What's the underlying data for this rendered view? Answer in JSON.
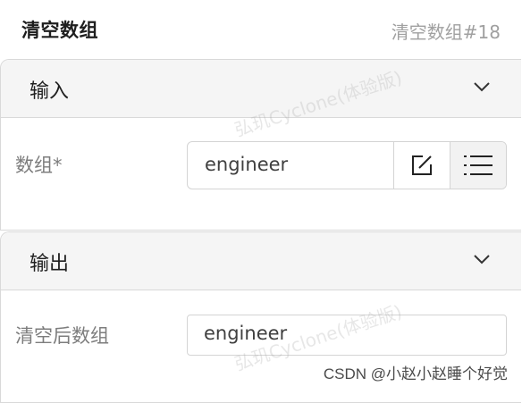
{
  "header": {
    "title": "清空数组",
    "node_id": "清空数组#18"
  },
  "input_section": {
    "title": "输入",
    "field_label": "数组*",
    "field_value": "engineer",
    "edit_icon": "edit-icon",
    "list_icon": "list-icon"
  },
  "output_section": {
    "title": "输出",
    "field_label": "清空后数组",
    "field_value": "engineer"
  },
  "watermark_text": "弘玑Cyclone(体验版)",
  "footer": {
    "credit": "CSDN @小赵小赵睡个好觉"
  }
}
